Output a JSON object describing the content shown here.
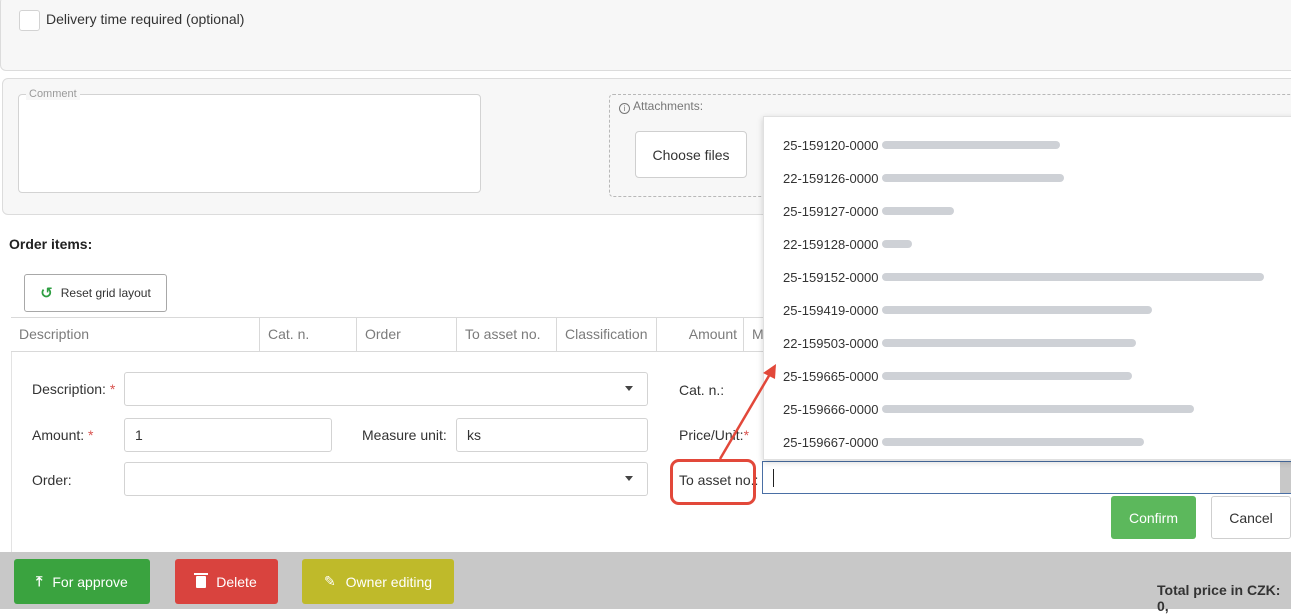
{
  "delivery": {
    "checkbox_label": "Delivery time required (optional)"
  },
  "comment": {
    "legend": "Comment"
  },
  "attachments": {
    "title": "Attachments:",
    "info_icon": "i",
    "choose_label": "Choose files"
  },
  "order_items": {
    "title": "Order items:"
  },
  "grid": {
    "reset_label": "Reset grid layout",
    "columns": [
      "Description",
      "Cat. n.",
      "Order",
      "To asset no.",
      "Classification",
      "Amount",
      "M"
    ]
  },
  "form": {
    "description_label": "Description:",
    "required_mark": "*",
    "amount_label": "Amount:",
    "amount_value": "1",
    "measure_label": "Measure unit:",
    "measure_value": "ks",
    "order_label": "Order:",
    "catn_label": "Cat. n.:",
    "price_label": "Price/Unit:",
    "asset_label": "To asset no.:"
  },
  "asset_dropdown": {
    "items": [
      "25-159120-0000",
      "22-159126-0000",
      "25-159127-0000",
      "22-159128-0000",
      "25-159152-0000",
      "25-159419-0000",
      "22-159503-0000",
      "25-159665-0000",
      "25-159666-0000",
      "25-159667-0000"
    ]
  },
  "actions": {
    "confirm": "Confirm",
    "cancel": "Cancel"
  },
  "footer": {
    "approve": "For approve",
    "delete": "Delete",
    "owner": "Owner editing",
    "total": "Total price in CZK: 0,"
  },
  "colors": {
    "green": "#3aa33f",
    "red": "#d9433e",
    "olive": "#bfba2a",
    "confirm": "#5cb85c",
    "highlight": "#e2483a"
  }
}
